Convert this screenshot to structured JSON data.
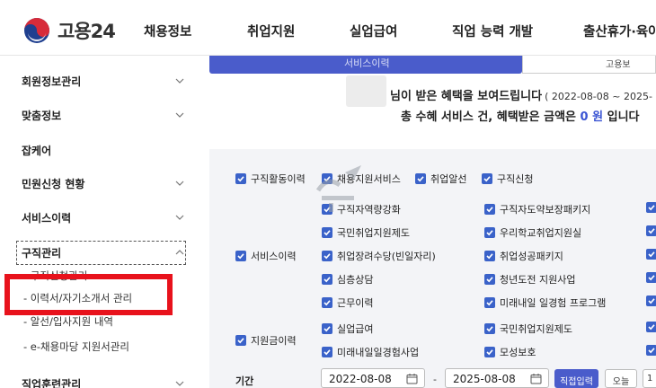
{
  "header": {
    "logo_text": "고용24",
    "nav": [
      "채용정보",
      "취업지원",
      "실업급여",
      "직업 능력 개발",
      "출산휴가·육아"
    ]
  },
  "sidebar": {
    "items": [
      "회원정보관리",
      "맞춤정보",
      "잡케어",
      "민원신청 현황",
      "서비스이력",
      "구직관리"
    ],
    "sub_items": [
      "- 구직신청관리",
      "- 이력서/자기소개서 관리",
      "- 알선/입사지원 내역",
      "- e-채용마당 지원서관리"
    ],
    "bottom_item": "직업훈련관리"
  },
  "tabs": {
    "active": "서비스이력",
    "other": "고용보"
  },
  "summary": {
    "line1": "님이 받은 혜택을 보여드립니다",
    "period": "( 2022-08-08 ~ 2025-",
    "line2_prefix": "총 수혜 서비스 건, 혜택받은 금액은",
    "amount": "0 원",
    "line2_suffix": "입니다"
  },
  "filter": {
    "categories": [
      "구직활동이력",
      "서비스이력",
      "지원금이력"
    ],
    "job_activity": [
      "채용지원서비스",
      "취업알선",
      "구직신청"
    ],
    "services": [
      "구직자역량강화",
      "구직자도약보장패키지",
      "국민취업지원제도",
      "우리학교취업지원실",
      "취업장려수당(빈일자리)",
      "취업성공패키지",
      "심층상담",
      "청년도전 지원사업",
      "근무이력",
      "미래내일 일경험 프로그램"
    ],
    "subsidies": [
      "실업급여",
      "국민취업지원제도",
      "미래내일일경험사업",
      "모성보호"
    ],
    "period_label": "기간",
    "date_from": "2022-08-08",
    "date_to": "2025-08-08",
    "date_separator": "-",
    "btn_direct": "직접입력",
    "btn_today": "오늘",
    "btn_more": "1"
  },
  "colors": {
    "accent": "#4a5ccb",
    "checkbox": "#3a62c9",
    "highlight": "#e8121c",
    "amount": "#3b55d3"
  }
}
